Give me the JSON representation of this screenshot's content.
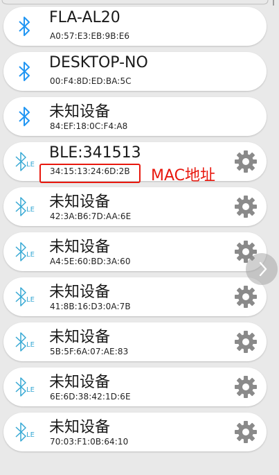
{
  "devices": [
    {
      "name": "FLA-AL20",
      "mac": "A0:57:E3:EB:9B:E6",
      "type": "classic",
      "has_settings": false
    },
    {
      "name": "DESKTOP-NO",
      "mac": "00:F4:8D:ED:BA:5C",
      "type": "classic",
      "has_settings": false
    },
    {
      "name": "未知设备",
      "mac": "84:EF:18:0C:F4:A8",
      "type": "classic",
      "has_settings": false
    },
    {
      "name": "BLE:341513",
      "mac": "34:15:13:24:6D:2B",
      "type": "ble",
      "has_settings": true
    },
    {
      "name": "未知设备",
      "mac": "42:3A:B6:7D:AA:6E",
      "type": "ble",
      "has_settings": true
    },
    {
      "name": "未知设备",
      "mac": "A4:5E:60:BD:3A:60",
      "type": "ble",
      "has_settings": true
    },
    {
      "name": "未知设备",
      "mac": "41:8B:16:D3:0A:7B",
      "type": "ble",
      "has_settings": true
    },
    {
      "name": "未知设备",
      "mac": "5B:5F:6A:07:AE:83",
      "type": "ble",
      "has_settings": true
    },
    {
      "name": "未知设备",
      "mac": "6E:6D:38:42:1D:6E",
      "type": "ble",
      "has_settings": true
    },
    {
      "name": "未知设备",
      "mac": "70:03:F1:0B:64:10",
      "type": "ble",
      "has_settings": true
    }
  ],
  "ble_badge": "LE",
  "annotation": {
    "label": "MAC地址",
    "color": "#e8170d"
  },
  "colors": {
    "bluetooth_classic": "#2196f3",
    "bluetooth_le": "#35a8d4",
    "gear": "#8a8a8a",
    "card": "#ffffff",
    "background": "#e9e9e9"
  },
  "icons": {
    "classic": "bluetooth-icon",
    "ble": "bluetooth-le-icon",
    "settings": "gear-icon",
    "scroll": "chevron-right-icon"
  }
}
